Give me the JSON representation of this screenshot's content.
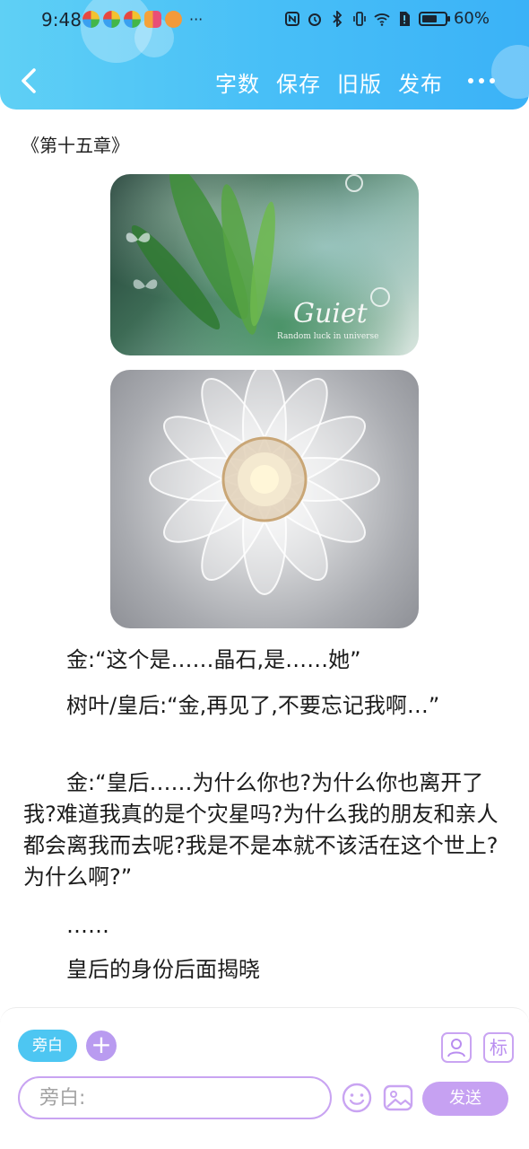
{
  "status_bar": {
    "time": "9:48",
    "notif_more": "···",
    "battery_text": "60%"
  },
  "header": {
    "actions": [
      "字数",
      "保存",
      "旧版",
      "发布"
    ],
    "accent": "#48bff7"
  },
  "content": {
    "chapter_title": "《第十五章》",
    "image1_logo_text": "Guiet",
    "image1_sub_text": "Random luck in universe",
    "paragraphs": [
      "金:“这个是……晶石,是……她”",
      "树叶/皇后:“金,再见了,不要忘记我啊…”",
      "金:“皇后……为什么你也?为什么你也离开了我?难道我真的是个灾星吗?为什么我的朋友和亲人都会离我而去呢?我是不是本就不该活在这个世上?为什么啊?”",
      "……",
      "皇后的身份后面揭晓"
    ]
  },
  "composer": {
    "role_chip": "旁白",
    "add_role": "+",
    "tag_button": "标",
    "input_placeholder": "旁白:",
    "send_label": "发送",
    "accent": "#c6a1f2"
  }
}
